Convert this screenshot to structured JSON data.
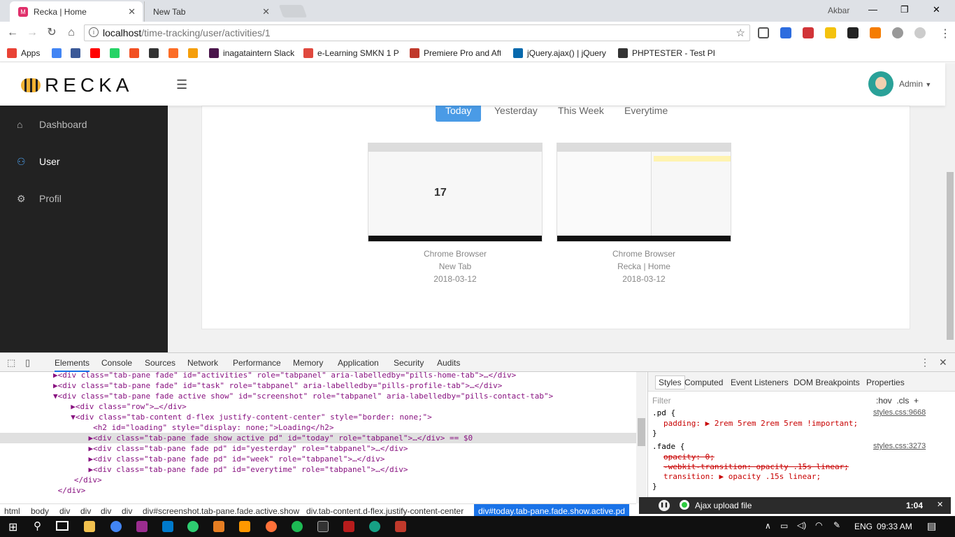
{
  "browser": {
    "tabs": [
      {
        "title": "Recka | Home",
        "close": "✕",
        "active": true
      },
      {
        "title": "New Tab",
        "close": "✕",
        "active": false
      }
    ],
    "user": "Akbar",
    "window_controls": {
      "minimize": "—",
      "maximize": "❐",
      "close": "✕"
    },
    "url_host": "localhost",
    "url_path": "/time-tracking/user/activities/1",
    "bookmarks": [
      {
        "label": "Apps",
        "color": "#e94235"
      },
      {
        "label": "",
        "color": "#4285f4"
      },
      {
        "label": "",
        "color": "#3b5998"
      },
      {
        "label": "",
        "color": "#ff0000"
      },
      {
        "label": "",
        "color": "#25d366"
      },
      {
        "label": "",
        "color": "#f25022"
      },
      {
        "label": "",
        "color": "#333333"
      },
      {
        "label": "",
        "color": "#fc6d26"
      },
      {
        "label": "",
        "color": "#f59e0b"
      },
      {
        "label": "inagataintern Slack",
        "color": "#4a154b"
      },
      {
        "label": "e-Learning SMKN 1 P",
        "color": "#e0483e"
      },
      {
        "label": "Premiere Pro and Aft",
        "color": "#c0392b"
      },
      {
        "label": "jQuery.ajax() | jQuery",
        "color": "#0769ad"
      },
      {
        "label": "PHPTESTER - Test PHP",
        "color": "#333333"
      }
    ]
  },
  "app": {
    "logo_text": "RECKA",
    "admin_label": "Admin",
    "sidebar": [
      {
        "label": "Dashboard",
        "icon": "⌂"
      },
      {
        "label": "User",
        "icon": "⚇"
      },
      {
        "label": "Profil",
        "icon": "⚙"
      }
    ],
    "pills": [
      "Today",
      "Yesterday",
      "This Week",
      "Everytime"
    ],
    "screenshots": [
      {
        "app": "Chrome Browser",
        "title": "New Tab",
        "date": "2018-03-12",
        "preview_text": "17"
      },
      {
        "app": "Chrome Browser",
        "title": "Recka | Home",
        "date": "2018-03-12",
        "preview_text": ""
      }
    ]
  },
  "devtools": {
    "tabs": [
      "Elements",
      "Console",
      "Sources",
      "Network",
      "Performance",
      "Memory",
      "Application",
      "Security",
      "Audits"
    ],
    "dom_lines": [
      "▶<div class=\"tab-pane fade\" id=\"activities\" role=\"tabpanel\" aria-labelledby=\"pills-home-tab\">…</div>",
      "▶<div class=\"tab-pane fade\" id=\"task\" role=\"tabpanel\" aria-labelledby=\"pills-profile-tab\">…</div>",
      "▼<div class=\"tab-pane fade active show\" id=\"screenshot\" role=\"tabpanel\" aria-labelledby=\"pills-contact-tab\">",
      "  ▶<div class=\"row\">…</div>",
      "  ▼<div class=\"tab-content d-flex justify-content-center\" style=\"border: none;\">",
      "     <h2 id=\"loading\" style=\"display: none;\">Loading</h2>",
      "    ▶<div class=\"tab-pane fade show active pd\" id=\"today\" role=\"tabpanel\">…</div> == $0",
      "    ▶<div class=\"tab-pane fade pd\" id=\"yesterday\" role=\"tabpanel\">…</div>",
      "    ▶<div class=\"tab-pane fade pd\" id=\"week\" role=\"tabpanel\">…</div>",
      "    ▶<div class=\"tab-pane fade pd\" id=\"everytime\" role=\"tabpanel\">…</div>",
      "   </div>",
      " </div>"
    ],
    "styles_tabs": [
      "Styles",
      "Computed",
      "Event Listeners",
      "DOM Breakpoints",
      "Properties"
    ],
    "filter_placeholder": "Filter",
    "filter_tools": ":hov  .cls  +",
    "rules": [
      {
        "selector": ".pd {",
        "source": "styles.css:9668",
        "decls": [
          "padding: ▶ 2rem 5rem 2rem 5rem !important;"
        ],
        "close": "}"
      },
      {
        "selector": ".fade {",
        "source": "styles.css:3273",
        "decls": [
          "opacity: 0;",
          "-webkit-transition: opacity .15s linear;",
          "transition: ▶ opacity .15s linear;"
        ],
        "close": "}"
      }
    ],
    "breadcrumbs": [
      "html",
      "body",
      "div",
      "div",
      "div",
      "div",
      "div#screenshot.tab-pane.fade.active.show",
      "div.tab-content.d-flex.justify-content-center",
      "div#today.tab-pane.fade.show.active.pd"
    ],
    "dots": "•••"
  },
  "toast": {
    "label": "Ajax upload file",
    "time": "1:04",
    "pause": "❚❚",
    "close": "✕"
  },
  "taskbar": {
    "lang": "ENG",
    "time": "09:33 AM"
  }
}
